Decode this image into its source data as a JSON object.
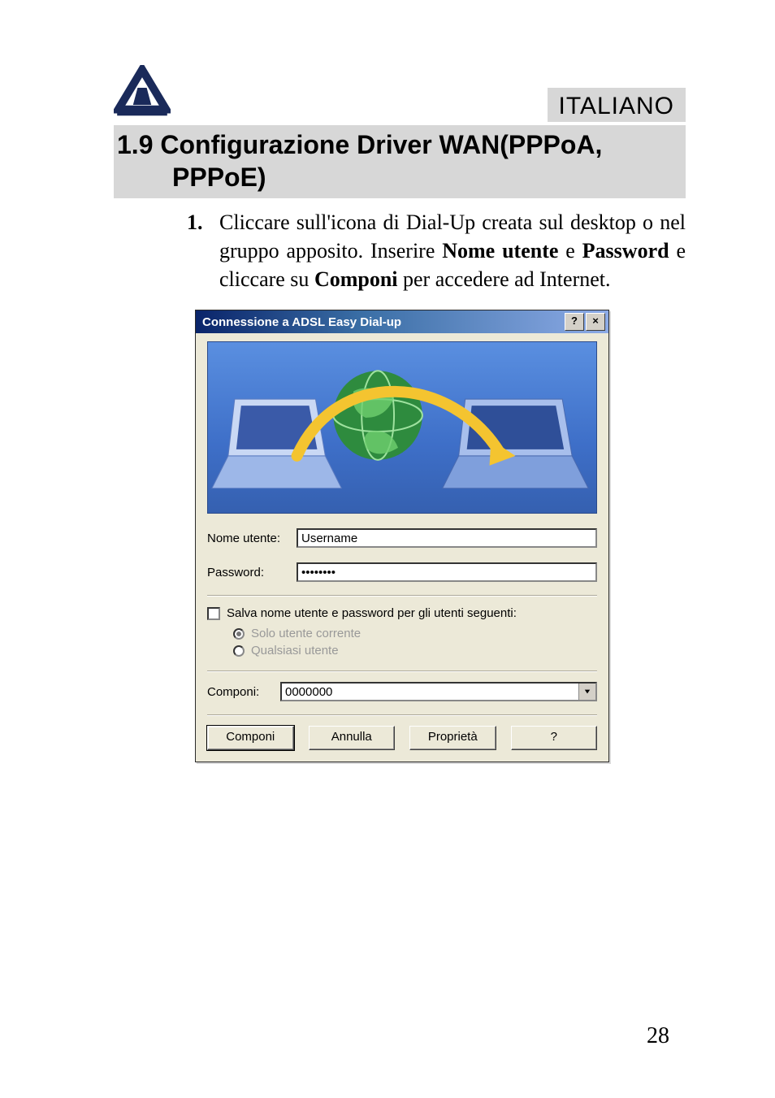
{
  "language_badge": "ITALIANO",
  "section_title_line1": "1.9 Configurazione Driver WAN(PPPoA,",
  "section_title_line2": "PPPoE)",
  "step_number": "1.",
  "step_text_before_bold1": "Cliccare sull'icona di Dial-Up creata sul desktop o nel gruppo apposito. Inserire ",
  "step_bold1": "Nome utente",
  "step_text_mid1": " e ",
  "step_bold2": "Password",
  "step_text_mid2": " e cliccare su ",
  "step_bold3": "Componi",
  "step_text_after": " per accedere ad Internet.",
  "dialog": {
    "title": "Connessione a ADSL Easy Dial-up",
    "help_btn": "?",
    "close_btn": "×",
    "username_label": "Nome utente:",
    "username_value": "Username",
    "password_label": "Password:",
    "password_value": "••••••••",
    "save_checkbox_label": "Salva nome utente e password per gli utenti seguenti:",
    "radio_current": "Solo utente corrente",
    "radio_any": "Qualsiasi utente",
    "dial_label": "Componi:",
    "dial_value": "0000000",
    "btn_connect": "Componi",
    "btn_cancel": "Annulla",
    "btn_props": "Proprietà",
    "btn_help": "?"
  },
  "page_number": "28"
}
